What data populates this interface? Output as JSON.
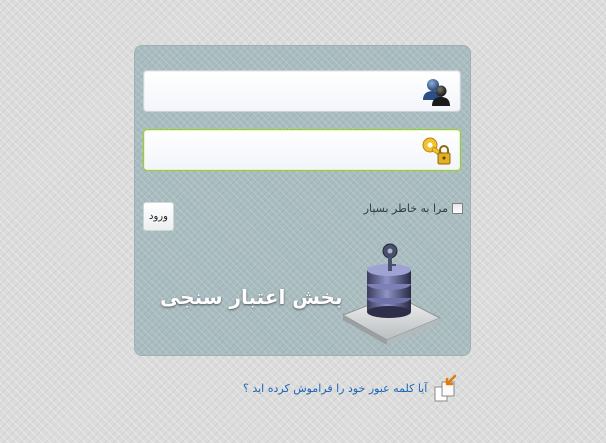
{
  "login": {
    "username_value": "",
    "password_value": "",
    "remember_label": "مرا به خاطر بسپار",
    "remember_checked": false,
    "submit_label": "ورود",
    "heading": "بخش اعتبار سنجی",
    "forgot_link": "آیا کلمه عبور خود را فراموش کرده اید ؟"
  },
  "icons": {
    "username": "user-icon",
    "password": "key-lock-icon",
    "section": "database-key-icon",
    "forgot": "forgot-password-icon"
  },
  "colors": {
    "panel_background": "#a9bcc0",
    "password_focus_border": "#9acd32",
    "link": "#1e66b5",
    "heading": "#ffffff"
  }
}
